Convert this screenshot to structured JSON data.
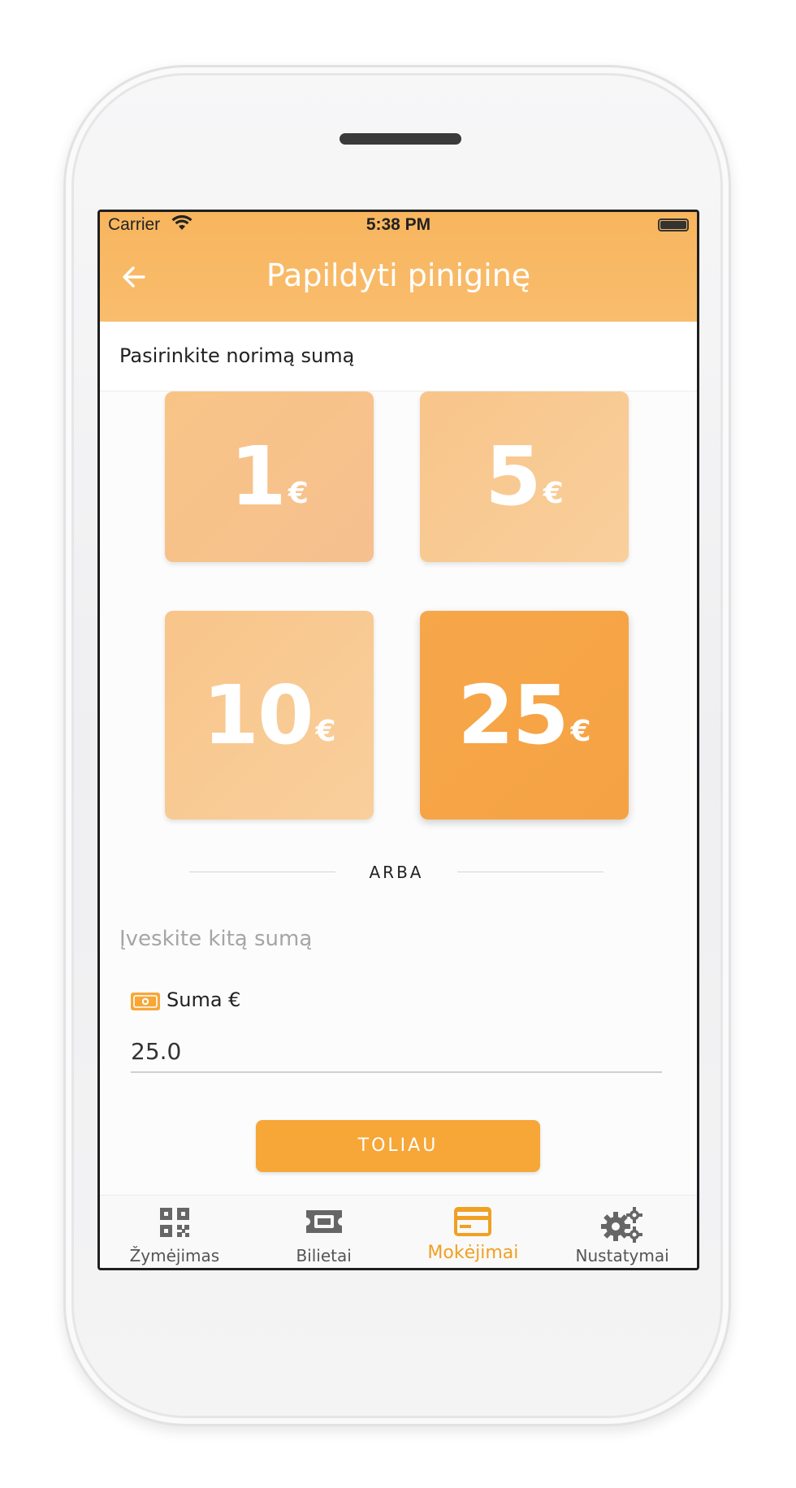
{
  "status_bar": {
    "carrier": "Carrier",
    "time": "5:38 PM"
  },
  "header": {
    "title": "Papildyti piniginę"
  },
  "subheader": {
    "text": "Pasirinkite norimą sumą"
  },
  "amounts": [
    {
      "value": "1",
      "currency": "€",
      "selected": false
    },
    {
      "value": "5",
      "currency": "€",
      "selected": false
    },
    {
      "value": "10",
      "currency": "€",
      "selected": false
    },
    {
      "value": "25",
      "currency": "€",
      "selected": true
    }
  ],
  "divider": {
    "text": "ARBA"
  },
  "other_amount": {
    "label": "Įveskite kitą sumą"
  },
  "sum_field": {
    "label": "Suma €",
    "value": "25.0"
  },
  "next_button": {
    "label": "TOLIAU"
  },
  "tabs": [
    {
      "label": "Žymėjimas",
      "icon": "qr-code-icon",
      "active": false
    },
    {
      "label": "Bilietai",
      "icon": "ticket-icon",
      "active": false
    },
    {
      "label": "Mokėjimai",
      "icon": "payment-card-icon",
      "active": true
    },
    {
      "label": "Nustatymai",
      "icon": "gears-icon",
      "active": false
    }
  ],
  "colors": {
    "accent": "#f6a738",
    "header": "#f8b55e",
    "tile_light": "#f8c486",
    "tile_selected": "#f6a74a",
    "tab_active": "#f0a022"
  }
}
